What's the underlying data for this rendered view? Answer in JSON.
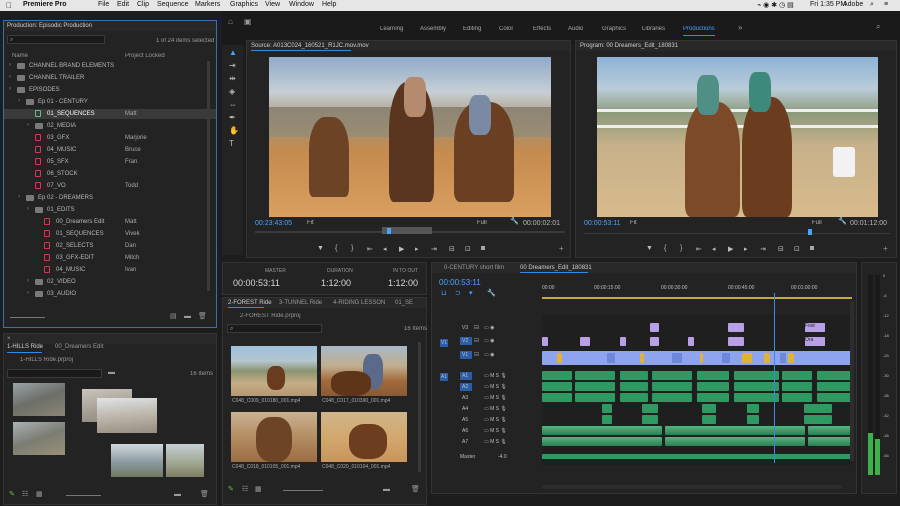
{
  "menubar": {
    "app": "Premiere Pro",
    "items": [
      "File",
      "Edit",
      "Clip",
      "Sequence",
      "Markers",
      "Graphics",
      "View",
      "Window",
      "Help"
    ],
    "time": "Fri 1:35 PM",
    "user": "Adobe"
  },
  "workspaces": [
    "Learning",
    "Assembly",
    "Editing",
    "Color",
    "Effects",
    "Audio",
    "Graphics",
    "Libraries",
    "Productions"
  ],
  "project": {
    "title": "Production: Episodic Production",
    "count": "1 of 24 items selected",
    "col_name": "Name",
    "col_locked": "Project Locked",
    "rows": [
      {
        "label": "CHANNEL BRAND ELEMENTS",
        "user": "",
        "indent": 1,
        "kind": "folder"
      },
      {
        "label": "CHANNEL TRAILER",
        "user": "",
        "indent": 1,
        "kind": "folder"
      },
      {
        "label": "EPISODES",
        "user": "",
        "indent": 1,
        "kind": "folder"
      },
      {
        "label": "Ep 01 - CENTURY",
        "user": "",
        "indent": 2,
        "kind": "folder"
      },
      {
        "label": "01_SEQUENCES",
        "user": "Matt",
        "indent": 3,
        "kind": "file",
        "sel": true
      },
      {
        "label": "02_MEDIA",
        "user": "",
        "indent": 3,
        "kind": "folder"
      },
      {
        "label": "03_GFX",
        "user": "Marjorie",
        "indent": 3,
        "kind": "file"
      },
      {
        "label": "04_MUSIC",
        "user": "Bruce",
        "indent": 3,
        "kind": "file"
      },
      {
        "label": "05_SFX",
        "user": "Fran",
        "indent": 3,
        "kind": "file"
      },
      {
        "label": "06_STOCK",
        "user": "",
        "indent": 3,
        "kind": "file"
      },
      {
        "label": "07_VO",
        "user": "Todd",
        "indent": 3,
        "kind": "file"
      },
      {
        "label": "Ep 02 - DREAMERS",
        "user": "",
        "indent": 2,
        "kind": "folder"
      },
      {
        "label": "01_EDITS",
        "user": "",
        "indent": 3,
        "kind": "folder"
      },
      {
        "label": "00_Dreamers Edit",
        "user": "Matt",
        "indent": 4,
        "kind": "file"
      },
      {
        "label": "01_SEQUENCES",
        "user": "Vivek",
        "indent": 4,
        "kind": "file"
      },
      {
        "label": "02_SELECTS",
        "user": "Dan",
        "indent": 4,
        "kind": "file"
      },
      {
        "label": "03_GFX-EDIT",
        "user": "Mitch",
        "indent": 4,
        "kind": "file"
      },
      {
        "label": "04_MUSIC",
        "user": "Ivan",
        "indent": 4,
        "kind": "file"
      },
      {
        "label": "02_VIDEO",
        "user": "",
        "indent": 3,
        "kind": "folder"
      },
      {
        "label": "03_AUDIO",
        "user": "",
        "indent": 3,
        "kind": "folder"
      }
    ]
  },
  "bin_left": {
    "tab1": "1-HILLS Ride",
    "tab2": "00_Dreamers Edit",
    "path": "1-HILLS Ride.prproj",
    "count": "16 Items"
  },
  "source": {
    "title": "Source: A013C024_160521_R1JC.mov.mov",
    "tc_left": "00:23:43:05",
    "fit": "Fit",
    "full": "Full",
    "tc_right": "00:00:02:01"
  },
  "program": {
    "title": "Program: 00 Dreamers_Edit_180831",
    "tc_left": "00:00:53:11",
    "fit": "Fit",
    "full": "Full",
    "tc_right": "00:01:12:00"
  },
  "info": {
    "master_lbl": "MASTER",
    "master_val": "00:00:53:11",
    "dur_lbl": "DURATION",
    "dur_val": "1:12:00",
    "inout_lbl": "IN TO OUT",
    "inout_val": "1:12:00"
  },
  "bin_mid": {
    "tabs": [
      "2-FOREST Ride",
      "3-TUNNEL Ride",
      "4-RIDING LESSON",
      "01_SE"
    ],
    "path": "2-FOREST Ride.prproj",
    "count": "16 Items",
    "thumbs": [
      "C048_C009_010180_001.mp4",
      "C048_C017_010390_001.mp4",
      "C048_C018_010105_001.mp4",
      "C048_C020_010104_001.mp4"
    ]
  },
  "timeline": {
    "tab1": "0-CENTURY short film",
    "tab2": "00 Dreamers_Edit_180831",
    "tc": "00:00:53:11",
    "ruler": [
      "00:00",
      "00:00:15:00",
      "00:00:30:00",
      "00:00:45:00",
      "00:01:00:00"
    ],
    "vtracks": [
      "V3",
      "V2",
      "V1"
    ],
    "atracks": [
      "A1",
      "A2",
      "A3",
      "A4",
      "A5",
      "A6",
      "A7"
    ],
    "master": "Master",
    "master_val": "-4.0",
    "src_v": "V1",
    "src_a": "A1",
    "clip_labels": [
      "Fost",
      "Ora"
    ]
  },
  "meter": [
    "0",
    "-6",
    "-12",
    "-18",
    "-24",
    "-30",
    "-36",
    "-42",
    "-48",
    "-54"
  ]
}
